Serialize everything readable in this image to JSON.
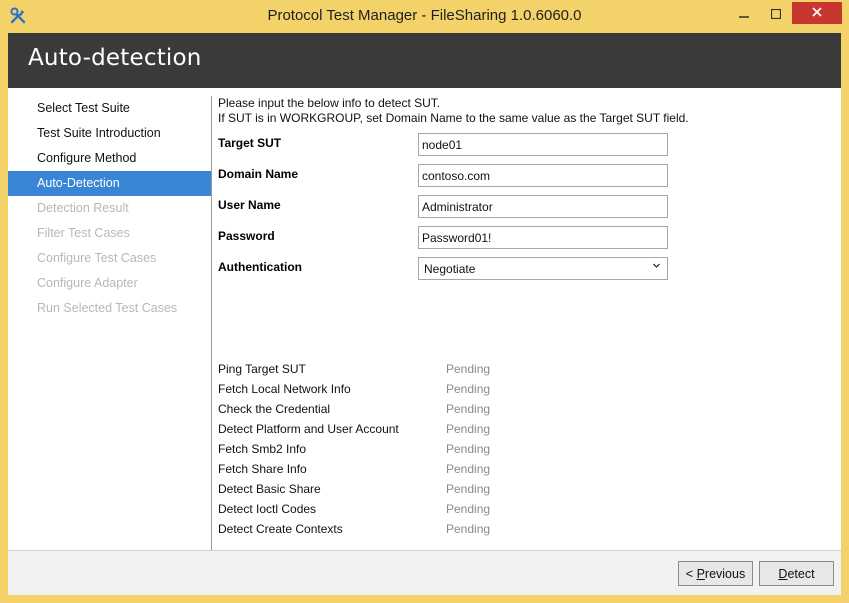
{
  "window": {
    "title": "Protocol Test Manager - FileSharing 1.0.6060.0",
    "min_icon": "minimize-icon",
    "max_icon": "maximize-icon",
    "close_icon": "close-icon",
    "app_icon": "tools-icon"
  },
  "header": {
    "title": "Auto-detection"
  },
  "sidebar": {
    "items": [
      {
        "label": "Select Test Suite",
        "state": "normal"
      },
      {
        "label": "Test Suite Introduction",
        "state": "normal"
      },
      {
        "label": "Configure Method",
        "state": "normal"
      },
      {
        "label": "Auto-Detection",
        "state": "active"
      },
      {
        "label": "Detection Result",
        "state": "disabled"
      },
      {
        "label": "Filter Test Cases",
        "state": "disabled"
      },
      {
        "label": "Configure Test Cases",
        "state": "disabled"
      },
      {
        "label": "Configure Adapter",
        "state": "disabled"
      },
      {
        "label": "Run Selected Test Cases",
        "state": "disabled"
      }
    ]
  },
  "intro": {
    "line1": "Please input the below info to detect SUT.",
    "line2": "If SUT is in WORKGROUP, set Domain Name to the same value as the Target SUT field."
  },
  "form": {
    "target_sut": {
      "label": "Target SUT",
      "value": "node01"
    },
    "domain_name": {
      "label": "Domain Name",
      "value": "contoso.com"
    },
    "user_name": {
      "label": "User Name",
      "value": "Administrator"
    },
    "password": {
      "label": "Password",
      "value": "Password01!"
    },
    "authentication": {
      "label": "Authentication",
      "value": "Negotiate",
      "arrow": "chevron-down-icon"
    }
  },
  "status": [
    {
      "name": "Ping Target SUT",
      "value": "Pending"
    },
    {
      "name": "Fetch Local Network Info",
      "value": "Pending"
    },
    {
      "name": "Check the Credential",
      "value": "Pending"
    },
    {
      "name": "Detect Platform and User Account",
      "value": "Pending"
    },
    {
      "name": "Fetch Smb2 Info",
      "value": "Pending"
    },
    {
      "name": "Fetch Share Info",
      "value": "Pending"
    },
    {
      "name": "Detect Basic Share",
      "value": "Pending"
    },
    {
      "name": "Detect Ioctl Codes",
      "value": "Pending"
    },
    {
      "name": "Detect Create Contexts",
      "value": "Pending"
    }
  ],
  "footer": {
    "previous_prefix": "< ",
    "previous_accel": "P",
    "previous_rest": "revious",
    "detect_accel": "D",
    "detect_rest": "etect"
  },
  "colors": {
    "accent": "#3a86d6",
    "titlebar": "#f4d26a",
    "header_band": "#3a3a3a",
    "close_button": "#c7372f"
  }
}
